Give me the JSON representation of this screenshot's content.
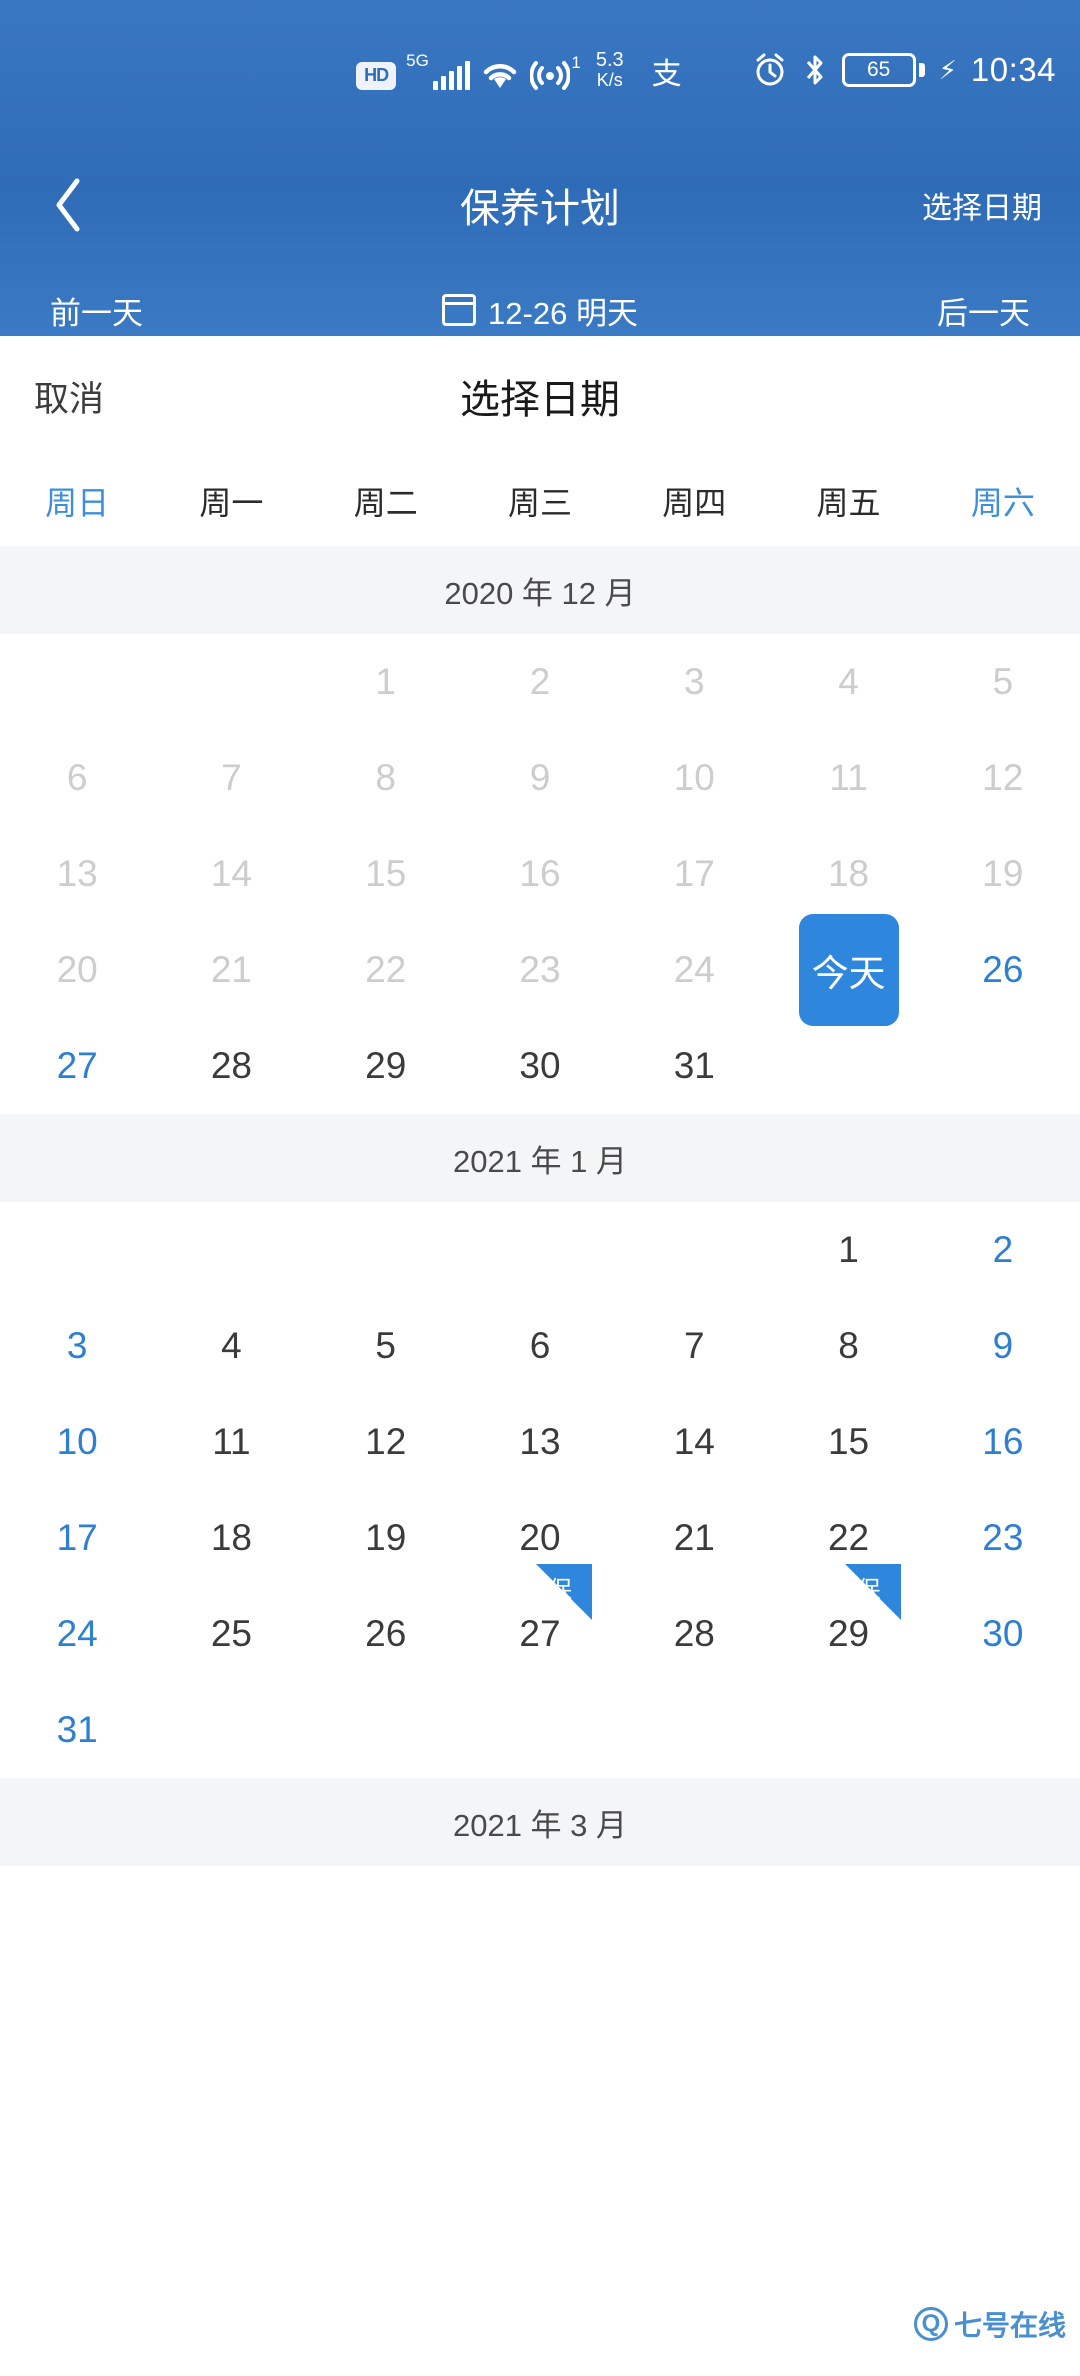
{
  "statusbar": {
    "hd_label": "HD",
    "network_gen": "5G",
    "hotspot_superscript": "1",
    "data_rate_value": "5.3",
    "data_rate_unit": "K/s",
    "alipay_glyph": "支",
    "battery_percent": "65",
    "time": "10:34",
    "icons": [
      "hd-icon",
      "signal-bars-icon",
      "wifi-icon",
      "hotspot-icon",
      "alipay-icon",
      "alarm-icon",
      "bluetooth-icon",
      "battery-icon",
      "charging-bolt-icon",
      "clock-text"
    ]
  },
  "navbar": {
    "back_icon": "chevron-left-icon",
    "title": "保养计划",
    "action_label": "选择日期"
  },
  "datenav": {
    "prev_label": "前一天",
    "calendar_icon": "calendar-icon",
    "current_label": "12-26 明天",
    "next_label": "后一天"
  },
  "sheet": {
    "cancel_label": "取消",
    "title": "选择日期",
    "weekdays": [
      {
        "label": "周日",
        "weekend": true
      },
      {
        "label": "周一",
        "weekend": false
      },
      {
        "label": "周二",
        "weekend": false
      },
      {
        "label": "周三",
        "weekend": false
      },
      {
        "label": "周四",
        "weekend": false
      },
      {
        "label": "周五",
        "weekend": false
      },
      {
        "label": "周六",
        "weekend": true
      }
    ],
    "months": [
      {
        "label": "2020 年 12 月",
        "lead_blanks": 2,
        "days": [
          {
            "n": "1",
            "state": "past"
          },
          {
            "n": "2",
            "state": "past"
          },
          {
            "n": "3",
            "state": "past"
          },
          {
            "n": "4",
            "state": "past"
          },
          {
            "n": "5",
            "state": "past"
          },
          {
            "n": "6",
            "state": "past"
          },
          {
            "n": "7",
            "state": "past"
          },
          {
            "n": "8",
            "state": "past"
          },
          {
            "n": "9",
            "state": "past"
          },
          {
            "n": "10",
            "state": "past"
          },
          {
            "n": "11",
            "state": "past"
          },
          {
            "n": "12",
            "state": "past"
          },
          {
            "n": "13",
            "state": "past"
          },
          {
            "n": "14",
            "state": "past"
          },
          {
            "n": "15",
            "state": "past"
          },
          {
            "n": "16",
            "state": "past"
          },
          {
            "n": "17",
            "state": "past"
          },
          {
            "n": "18",
            "state": "past"
          },
          {
            "n": "19",
            "state": "past"
          },
          {
            "n": "20",
            "state": "past"
          },
          {
            "n": "21",
            "state": "past"
          },
          {
            "n": "22",
            "state": "past"
          },
          {
            "n": "23",
            "state": "past"
          },
          {
            "n": "24",
            "state": "past"
          },
          {
            "n": "今天",
            "state": "today"
          },
          {
            "n": "26",
            "state": "weekend"
          },
          {
            "n": "27",
            "state": "weekend"
          },
          {
            "n": "28",
            "state": "normal"
          },
          {
            "n": "29",
            "state": "normal"
          },
          {
            "n": "30",
            "state": "normal"
          },
          {
            "n": "31",
            "state": "normal"
          }
        ]
      },
      {
        "label": "2021 年 1 月",
        "lead_blanks": 5,
        "days": [
          {
            "n": "1",
            "state": "normal"
          },
          {
            "n": "2",
            "state": "weekend"
          },
          {
            "n": "3",
            "state": "weekend"
          },
          {
            "n": "4",
            "state": "normal"
          },
          {
            "n": "5",
            "state": "normal"
          },
          {
            "n": "6",
            "state": "normal"
          },
          {
            "n": "7",
            "state": "normal"
          },
          {
            "n": "8",
            "state": "normal"
          },
          {
            "n": "9",
            "state": "weekend"
          },
          {
            "n": "10",
            "state": "weekend"
          },
          {
            "n": "11",
            "state": "normal"
          },
          {
            "n": "12",
            "state": "normal"
          },
          {
            "n": "13",
            "state": "normal"
          },
          {
            "n": "14",
            "state": "normal"
          },
          {
            "n": "15",
            "state": "normal"
          },
          {
            "n": "16",
            "state": "weekend"
          },
          {
            "n": "17",
            "state": "weekend"
          },
          {
            "n": "18",
            "state": "normal"
          },
          {
            "n": "19",
            "state": "normal"
          },
          {
            "n": "20",
            "state": "normal"
          },
          {
            "n": "21",
            "state": "normal"
          },
          {
            "n": "22",
            "state": "normal"
          },
          {
            "n": "23",
            "state": "weekend"
          },
          {
            "n": "24",
            "state": "weekend"
          },
          {
            "n": "25",
            "state": "normal"
          },
          {
            "n": "26",
            "state": "normal"
          },
          {
            "n": "27",
            "state": "normal",
            "flag": "保"
          },
          {
            "n": "28",
            "state": "normal"
          },
          {
            "n": "29",
            "state": "normal",
            "flag": "保"
          },
          {
            "n": "30",
            "state": "weekend"
          },
          {
            "n": "31",
            "state": "weekend"
          }
        ]
      },
      {
        "label": "2021 年 3 月",
        "lead_blanks": 0,
        "days": []
      }
    ]
  },
  "watermark": {
    "mark": "Q",
    "text": "七号在线"
  },
  "colors": {
    "header_blue": "#2f6cb8",
    "accent_blue": "#2f86dd",
    "weekend_blue": "#2f7fd0",
    "past_gray": "#cdcdcd",
    "month_band": "#f4f5f7"
  }
}
